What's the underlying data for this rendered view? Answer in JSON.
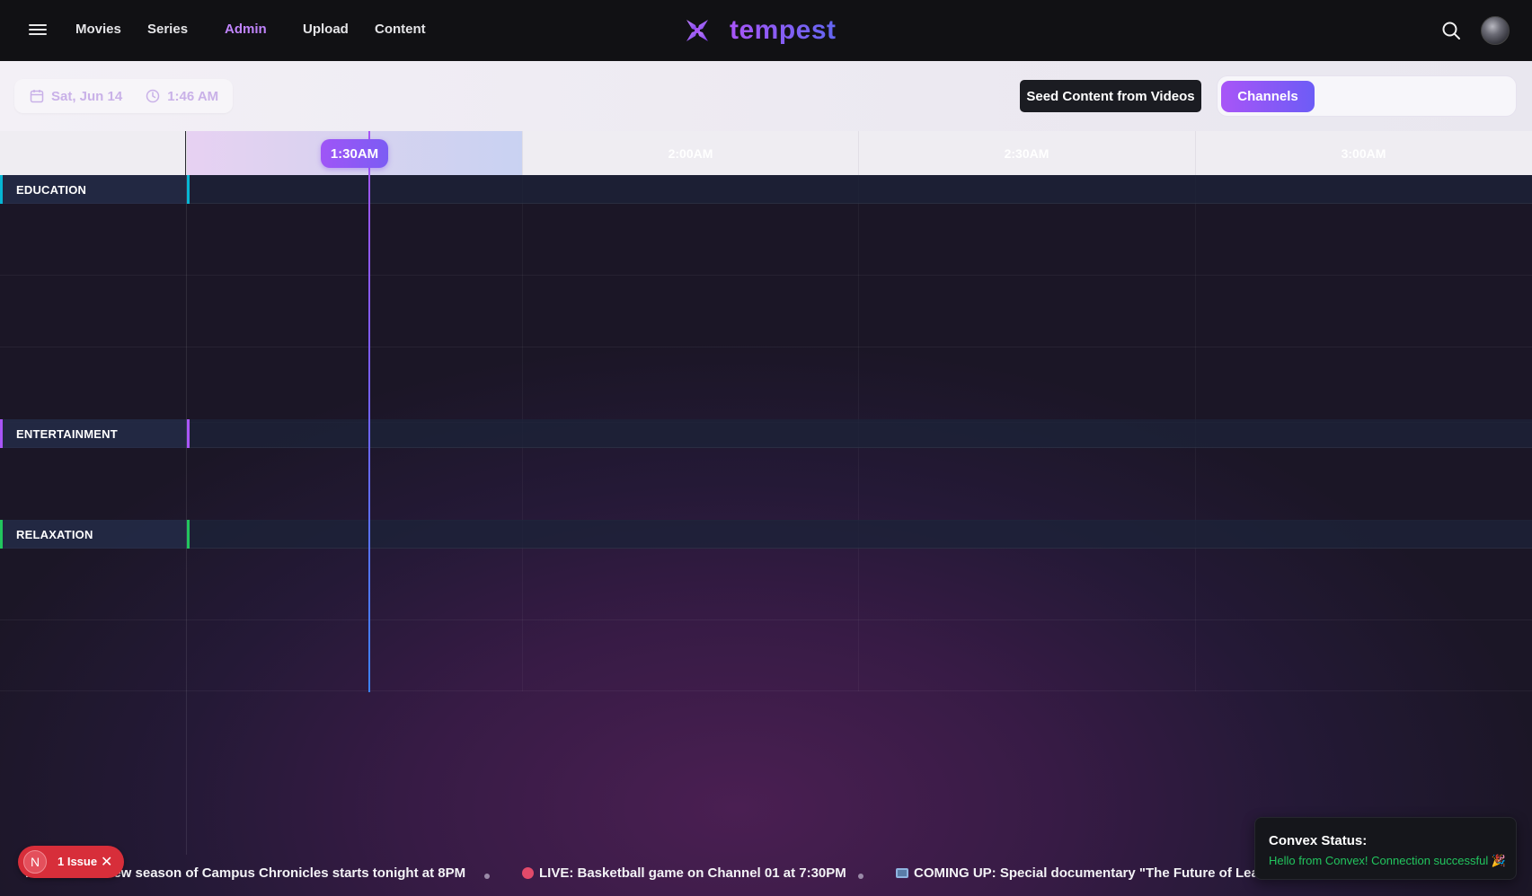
{
  "nav": {
    "links": [
      "Movies",
      "Series",
      "Admin",
      "Upload",
      "Content"
    ],
    "active": "Admin",
    "brand": "tempest",
    "brand_color": "#8b5cf6"
  },
  "controls": {
    "date": "Sat, Jun 14",
    "time": "1:46 AM",
    "seed_button": "Seed Content from Videos",
    "view_button": "Channels"
  },
  "timeline": {
    "current_badge": "1:30AM",
    "slots": [
      "1:30AM",
      "2:00AM",
      "2:30AM",
      "3:00AM"
    ]
  },
  "groups": [
    {
      "label": "EDUCATION",
      "accent": "#06b6d4"
    },
    {
      "label": "ENTERTAINMENT",
      "accent": "#a855f7"
    },
    {
      "label": "RELAXATION",
      "accent": "#22c55e"
    }
  ],
  "ticker": {
    "items": [
      "PREMIERE: New season of Campus Chronicles starts tonight at 8PM",
      "LIVE: Basketball game on Channel 01 at 7:30PM",
      "COMING UP: Special documentary \"The Future of Learning\""
    ]
  },
  "issue_badge": {
    "letter": "N",
    "text": "1 Issue",
    "close": "✕"
  },
  "toast": {
    "title": "Convex Status:",
    "message": "Hello from Convex! Connection successful 🎉"
  }
}
